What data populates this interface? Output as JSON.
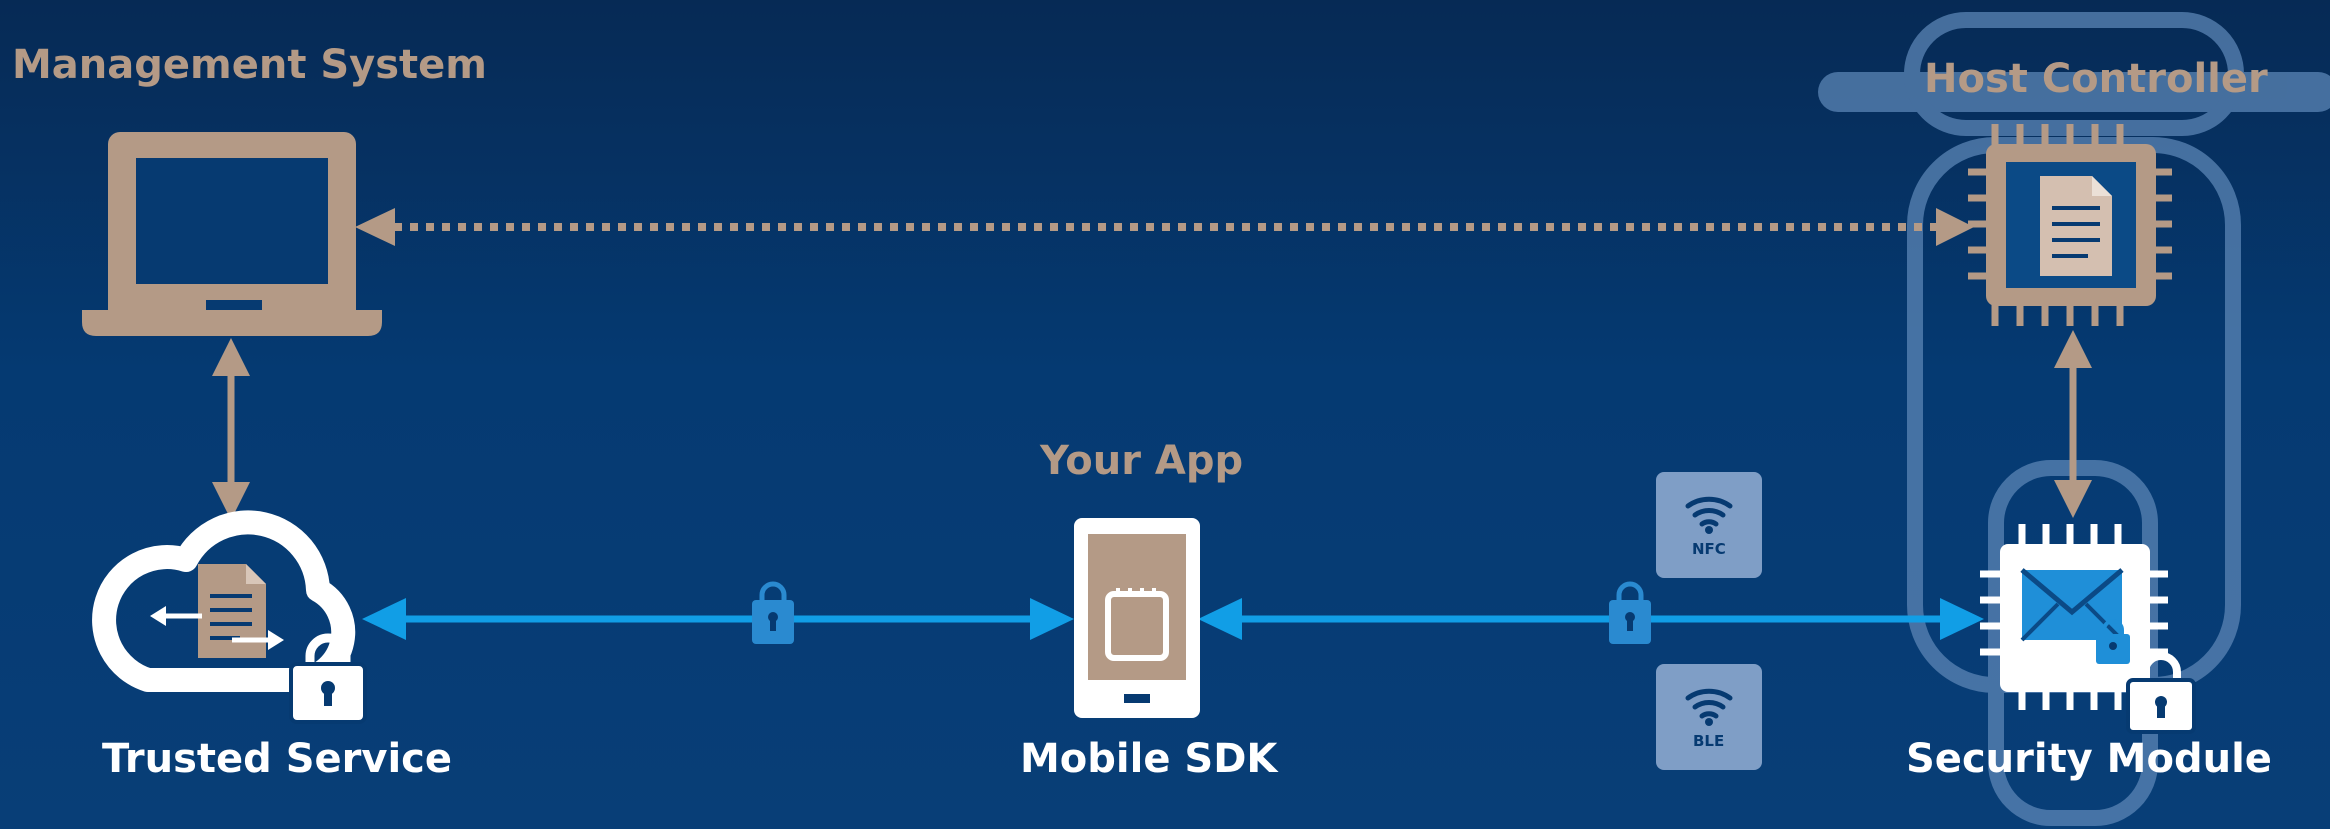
{
  "labels": {
    "management_system": "Management System",
    "host_controller": "Host Controller",
    "your_app": "Your App",
    "trusted_service": "Trusted Service",
    "mobile_sdk": "Mobile SDK",
    "security_module": "Security Module",
    "nfc": "NFC",
    "ble": "BLE"
  },
  "colors": {
    "background_top": "#062a55",
    "background_bottom": "#083e77",
    "tan": "#b49a86",
    "accent_blue": "#119ee6",
    "lock_blue": "#2a8ad0",
    "outline_blue": "#5b85b5",
    "white": "#ffffff"
  },
  "icons": [
    "laptop-icon",
    "cloud-document-icon",
    "padlock-icon",
    "smartphone-icon",
    "chip-document-icon",
    "chip-envelope-icon",
    "wifi-icon"
  ]
}
